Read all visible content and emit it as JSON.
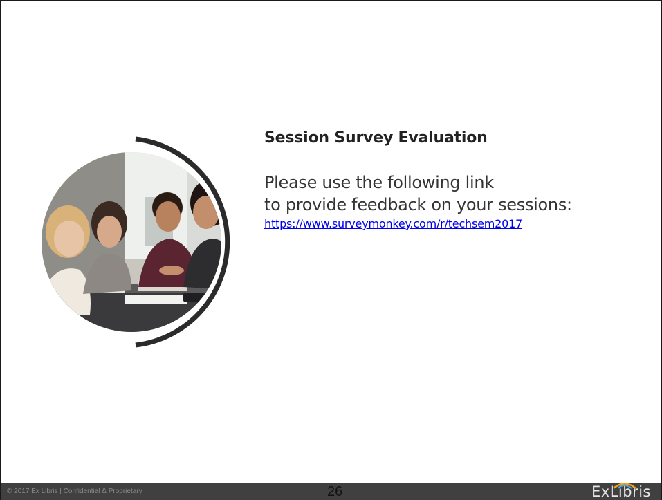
{
  "slide": {
    "title": "Session Survey Evaluation",
    "body_line_1": "Please use the following link",
    "body_line_2": "to provide feedback on your sessions:",
    "link_text": "https://www.surveymonkey.com/r/techsem2017"
  },
  "footer": {
    "copyright": "© 2017 Ex Libris | Confidential & Proprietary",
    "page_number": "26",
    "logo_text": "ExLibris"
  },
  "colors": {
    "footer_bg": "#404040",
    "link": "#0000ee",
    "arc": "#2b2b2b"
  },
  "icons": {
    "photo": "students-studying-photo",
    "arc": "decorative-arc",
    "logo": "exlibris-logo"
  }
}
